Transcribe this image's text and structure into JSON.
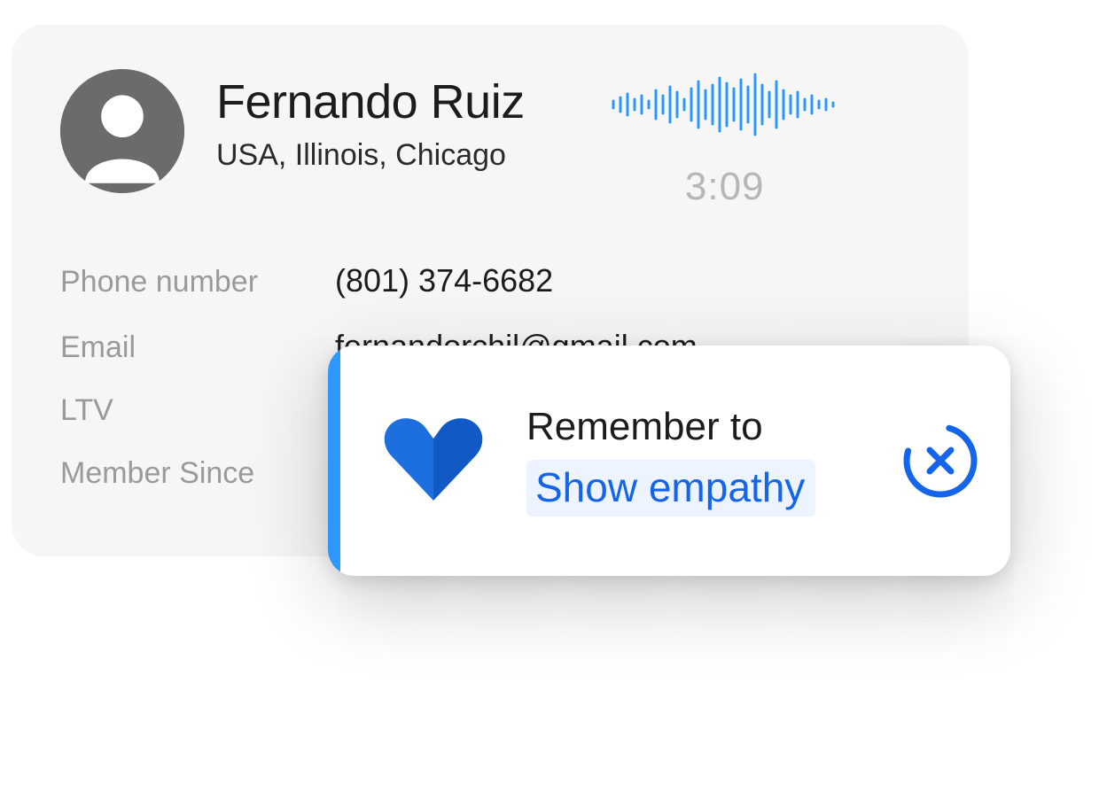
{
  "profile": {
    "name": "Fernando Ruiz",
    "location": "USA, Illinois, Chicago"
  },
  "call": {
    "timer": "3:09"
  },
  "details": {
    "phone_label": "Phone number",
    "phone_value": "(801) 374-6682",
    "email_label": "Email",
    "email_value": "fernandorchil@gmail.com",
    "ltv_label": "LTV",
    "member_label": "Member Since"
  },
  "tip": {
    "line1": "Remember to",
    "line2": "Show empathy"
  },
  "colors": {
    "accent": "#2f98ff",
    "link": "#1565ea"
  }
}
